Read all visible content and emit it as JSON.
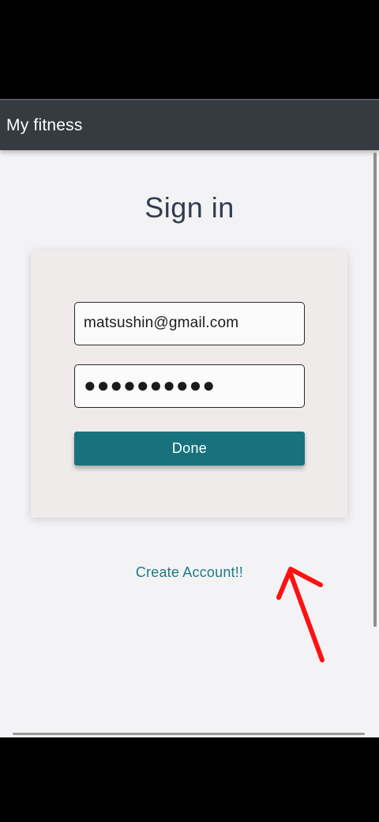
{
  "app": {
    "title": "My fitness"
  },
  "signin": {
    "heading": "Sign in",
    "email_value": "matsushin@gmail.com",
    "password_value": "●●●●●●●●●●",
    "done_label": "Done",
    "create_account_label": "Create Account!!"
  },
  "colors": {
    "app_bar": "#363a41",
    "accent": "#18727e",
    "link": "#1b7b86",
    "annotation_arrow": "#ff1010"
  }
}
